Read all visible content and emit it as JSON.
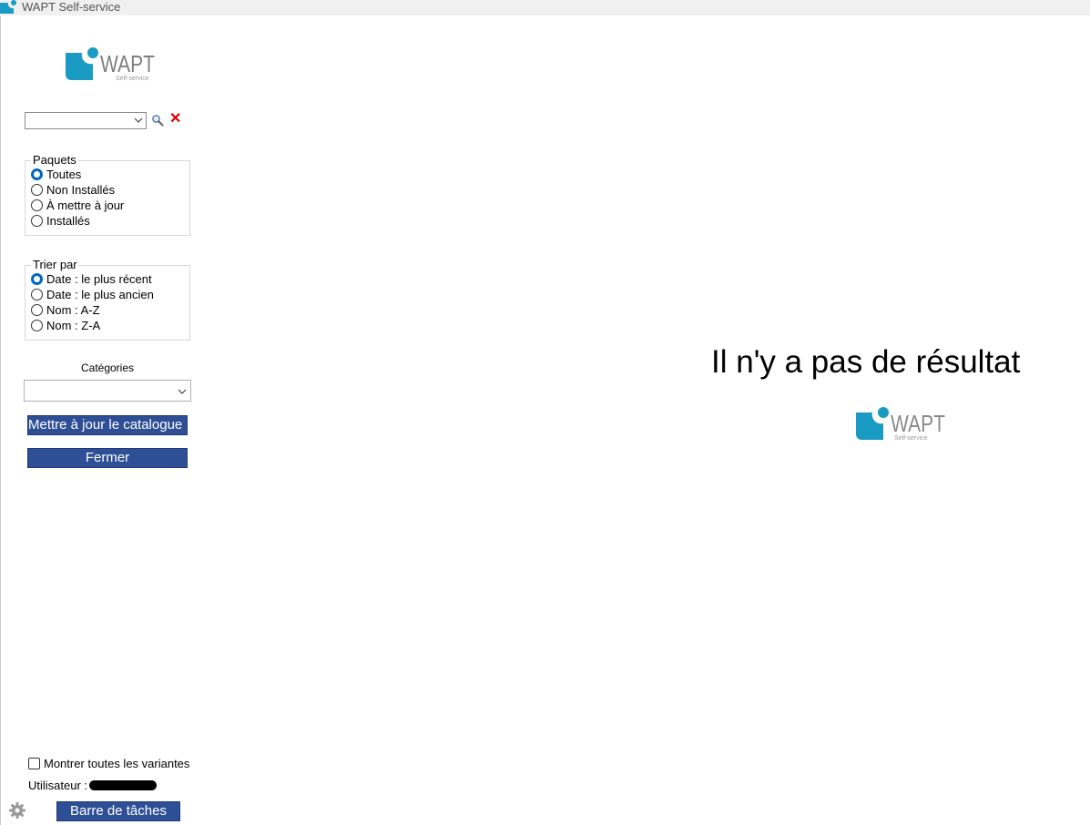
{
  "window": {
    "title": "WAPT Self-service"
  },
  "brand": {
    "name": "WAPT",
    "tagline": "Self-service",
    "color": "#1a9bc3"
  },
  "search": {
    "value": ""
  },
  "packages": {
    "legend": "Paquets",
    "options": [
      "Toutes",
      "Non Installés",
      "À mettre à jour",
      "Installés"
    ],
    "selected": "Toutes"
  },
  "sort": {
    "legend": "Trier par",
    "options": [
      "Date : le plus récent",
      "Date : le plus ancien",
      "Nom : A-Z",
      "Nom : Z-A"
    ],
    "selected": "Date : le plus récent"
  },
  "categories": {
    "label": "Catégories",
    "value": ""
  },
  "buttons": {
    "update_catalog": "Mettre à jour le catalogue",
    "close": "Fermer",
    "taskbar": "Barre de tâches"
  },
  "show_variants": {
    "label": "Montrer toutes les variantes",
    "checked": false
  },
  "user": {
    "label": "Utilisateur :"
  },
  "main": {
    "message": "Il n'y a pas de résultat"
  },
  "colors": {
    "button_bg": "#2e4f95",
    "radio_selected": "#0067c0",
    "clear_icon": "#d60000"
  }
}
